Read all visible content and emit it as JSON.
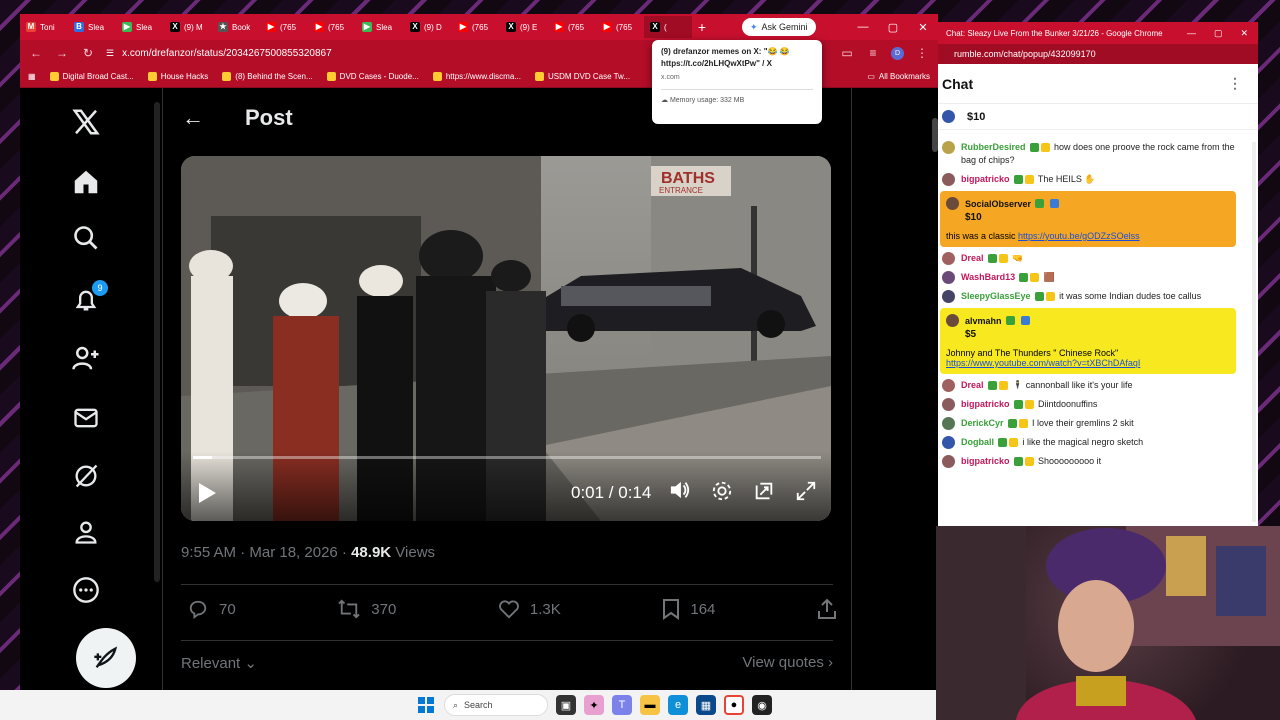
{
  "browser": {
    "tabs": [
      {
        "label": "Toni",
        "color": "#ea4335",
        "glyph": "M"
      },
      {
        "label": "Slea",
        "color": "#2f6fe4",
        "glyph": "B"
      },
      {
        "label": "Slea",
        "color": "#3cba54",
        "glyph": "▶"
      },
      {
        "label": "(9) M",
        "color": "#000000",
        "glyph": "X"
      },
      {
        "label": "Book",
        "color": "#555555",
        "glyph": "★"
      },
      {
        "label": "(765",
        "color": "#ff0000",
        "glyph": "▶"
      },
      {
        "label": "(765",
        "color": "#ff0000",
        "glyph": "▶"
      },
      {
        "label": "Slea",
        "color": "#3cba54",
        "glyph": "▶"
      },
      {
        "label": "(9) D",
        "color": "#000000",
        "glyph": "X"
      },
      {
        "label": "(765",
        "color": "#ff0000",
        "glyph": "▶"
      },
      {
        "label": "(9) E",
        "color": "#000000",
        "glyph": "X"
      },
      {
        "label": "(765",
        "color": "#ff0000",
        "glyph": "▶"
      },
      {
        "label": "(765",
        "color": "#ff0000",
        "glyph": "▶"
      },
      {
        "label": "(",
        "color": "#000000",
        "glyph": "X"
      }
    ],
    "ask_gemini": "Ask Gemini",
    "url": "x.com/drefanzor/status/2034267500855320867",
    "bookmarks": [
      "Digital Broad Cast...",
      "House Hacks",
      "(8) Behind the Scen...",
      "DVD Cases - Duode...",
      "https://www.discma...",
      "USDM DVD Case Tw..."
    ],
    "all_bookmarks": "All Bookmarks",
    "tooltip": {
      "title": "(9) drefanzor memes on X: \"😂 😂 https://t.co/2hLHQwXtPw\" / X",
      "domain": "x.com",
      "memory": "Memory usage: 332 MB"
    }
  },
  "x": {
    "notification_count": "9",
    "header_title": "Post",
    "video": {
      "time": "0:01 / 0:14",
      "progress": 0.03,
      "sign_text": "BATHS",
      "sign_sub": "ENTRANCE"
    },
    "meta": {
      "time": "9:55 AM · Mar 18, 2026 · ",
      "views_count": "48.9K",
      "views_label": " Views"
    },
    "actions": {
      "replies": "70",
      "reposts": "370",
      "likes": "1.3K",
      "bookmarks": "164"
    },
    "sort_label": "Relevant",
    "view_quotes": "View quotes"
  },
  "chat": {
    "window_title": "Chat: Sleazy Live From the Bunker 3/21/26 - Google Chrome",
    "url": "rumble.com/chat/popup/432099170",
    "header": "Chat",
    "pinned_amount": "$10",
    "messages": [
      {
        "user": "RubberDesired",
        "ucolor": "#3aa03a",
        "text": "how does one proove the rock came from the bag of chips?",
        "avatar": "#b9a24a"
      },
      {
        "user": "bigpatricko",
        "ucolor": "#c2185b",
        "text": "The HEILS ✋",
        "avatar": "#8b5a5a"
      },
      {
        "user": "Dreal",
        "ucolor": "#c2185b",
        "text": "🤜",
        "avatar": "#a06060"
      },
      {
        "user": "WashBard13",
        "ucolor": "#c2185b",
        "text": "🟫",
        "avatar": "#6b4a7a"
      },
      {
        "user": "SleepyGlassEye",
        "ucolor": "#3aa03a",
        "text": "it was some Indian dudes toe callus",
        "avatar": "#444466"
      },
      {
        "user": "Dreal",
        "ucolor": "#c2185b",
        "text": "🕴 cannonball like it's your life",
        "avatar": "#a06060"
      },
      {
        "user": "bigpatricko",
        "ucolor": "#c2185b",
        "text": "Diintdoonuffins",
        "avatar": "#8b5a5a"
      },
      {
        "user": "DerickCyr",
        "ucolor": "#3aa03a",
        "text": "I love their gremlins 2 skit",
        "avatar": "#557755"
      },
      {
        "user": "Dogball",
        "ucolor": "#3aa03a",
        "text": "i like the magical negro sketch",
        "avatar": "#3355aa"
      },
      {
        "user": "bigpatricko",
        "ucolor": "#c2185b",
        "text": "Shooooooooo it",
        "avatar": "#8b5a5a"
      }
    ],
    "rants": [
      {
        "user": "SocialObserver",
        "amount": "$10",
        "text": "this was a classic ",
        "link": "https://youtu.be/gODZzSOelss",
        "bg": "#f5a623"
      },
      {
        "user": "alvmahn",
        "amount": "$5",
        "text": "Johnny and The Thunders \" Chinese Rock\" ",
        "link": "https://www.youtube.com/watch?v=tXBChDAfaqI",
        "bg": "#f7e81f"
      }
    ]
  },
  "taskbar": {
    "search_label": "Search"
  }
}
